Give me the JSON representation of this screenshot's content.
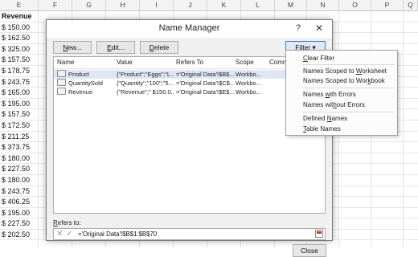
{
  "sheet": {
    "columns": [
      "E",
      "F",
      "G",
      "H",
      "I",
      "J",
      "K",
      "L",
      "M",
      "N",
      "O",
      "P",
      "Q"
    ],
    "header": "Revenue",
    "values": [
      "$ 150.00",
      "$ 162.50",
      "$ 325.00",
      "$ 157.50",
      "$ 178.75",
      "$ 243.75",
      "$ 165.00",
      "$ 195.00",
      "$ 157.50",
      "$ 172.50",
      "$ 211.25",
      "$ 373.75",
      "$ 180.00",
      "$ 227.50",
      "$ 180.00",
      "$ 243.75",
      "$ 406.25",
      "$ 195.00",
      "$ 227.50",
      "$ 202.50"
    ]
  },
  "dialog": {
    "title": "Name Manager",
    "help": "?",
    "close_glyph": "✕",
    "buttons": {
      "new": {
        "pre": "",
        "key": "N",
        "post": "ew..."
      },
      "edit": {
        "pre": "",
        "key": "E",
        "post": "dit..."
      },
      "delete": {
        "pre": "",
        "key": "D",
        "post": "elete"
      },
      "filter": {
        "pre": "",
        "key": "F",
        "post": "ilter ▾"
      },
      "close": "Close"
    },
    "columns": {
      "name": "Name",
      "value": "Value",
      "refers_to": "Refers To",
      "scope": "Scope",
      "comment": "Comme"
    },
    "rows": [
      {
        "name": "Product",
        "value": "{\"Product\";\"Eggs\";\"L...",
        "refers": "='Original Data'!$B$...",
        "scope": "Workbo...",
        "selected": true
      },
      {
        "name": "QuantitySold",
        "value": "{\"Quantity\";\"100\";\"5...",
        "refers": "='Original Data'!$C$...",
        "scope": "Workbo...",
        "selected": false
      },
      {
        "name": "Revenue",
        "value": "{\"Revenue\";\" $150.0...",
        "refers": "='Original Data'!$E$...",
        "scope": "Workbo...",
        "selected": false
      }
    ],
    "refers_label": {
      "pre": "",
      "key": "R",
      "post": "efers to:"
    },
    "refers_value": "='Original Data'!$B$1:$B$70",
    "icons": {
      "cancel": "✕",
      "enter": "✓"
    }
  },
  "filter_menu": {
    "items": [
      {
        "pre": "",
        "key": "C",
        "post": "lear Filter"
      },
      {
        "pre": "Names Scoped to ",
        "key": "W",
        "post": "orksheet"
      },
      {
        "pre": "Names Scoped to Wor",
        "key": "k",
        "post": "book"
      },
      {
        "pre": "Names ",
        "key": "w",
        "post": "ith Errors"
      },
      {
        "pre": "Names wit",
        "key": "h",
        "post": "out Errors"
      },
      {
        "pre": "Defined ",
        "key": "N",
        "post": "ames"
      },
      {
        "pre": "",
        "key": "T",
        "post": "able Names"
      }
    ]
  },
  "colors": {
    "accent": "#3c7fb1",
    "selection": "#dfe7f2"
  }
}
